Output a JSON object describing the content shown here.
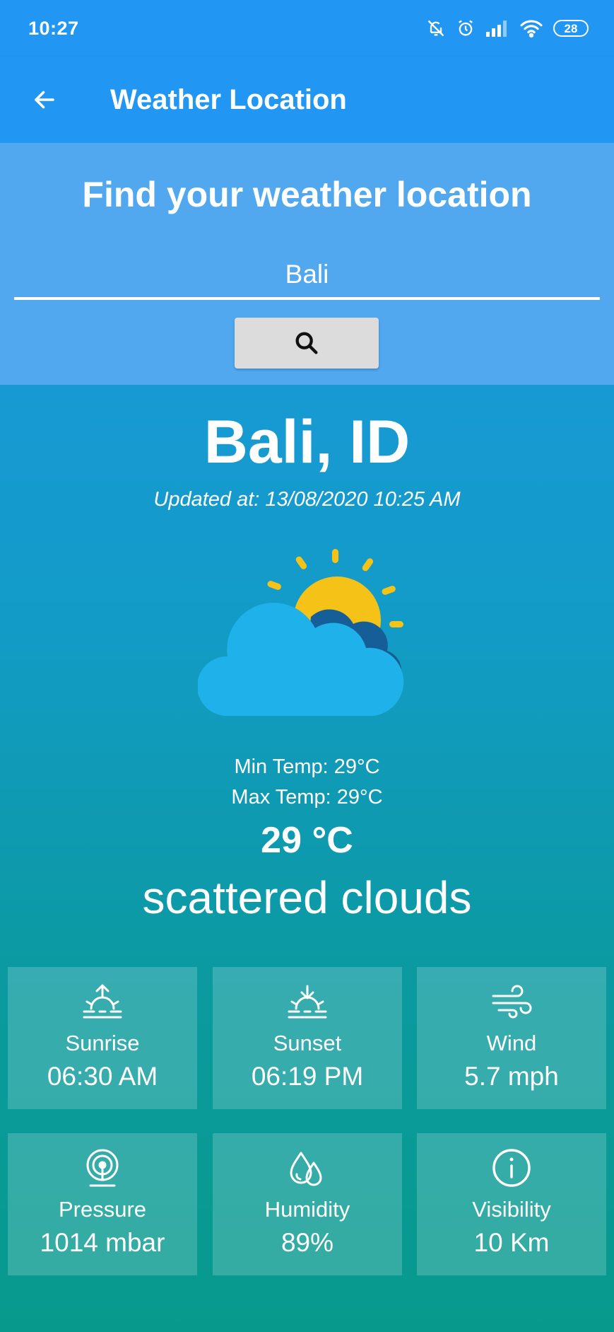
{
  "status_bar": {
    "time": "10:27",
    "battery": "28"
  },
  "app_bar": {
    "title": "Weather Location",
    "back_icon": "arrow-left-icon"
  },
  "search": {
    "heading": "Find your weather location",
    "value": "Bali",
    "button_icon": "search-icon"
  },
  "weather": {
    "location": "Bali, ID",
    "updated_at": "Updated at: 13/08/2020 10:25 AM",
    "icon": "partly-cloudy-icon",
    "min_temp": "Min Temp: 29°C",
    "max_temp": "Max Temp: 29°C",
    "temp": "29 °C",
    "description": "scattered clouds"
  },
  "details": [
    {
      "label": "Sunrise",
      "value": "06:30 AM",
      "icon": "sunrise-icon"
    },
    {
      "label": "Sunset",
      "value": "06:19 PM",
      "icon": "sunset-icon"
    },
    {
      "label": "Wind",
      "value": "5.7 mph",
      "icon": "wind-icon"
    },
    {
      "label": "Pressure",
      "value": "1014 mbar",
      "icon": "pressure-icon"
    },
    {
      "label": "Humidity",
      "value": "89%",
      "icon": "humidity-icon"
    },
    {
      "label": "Visibility",
      "value": "10 Km",
      "icon": "info-icon"
    }
  ],
  "colors": {
    "app_bar": "#2196f3",
    "search_section": "#51a8ef",
    "gradient_top": "#1f97e6",
    "gradient_bottom": "#079a8c",
    "search_button": "#dcdcdc"
  }
}
